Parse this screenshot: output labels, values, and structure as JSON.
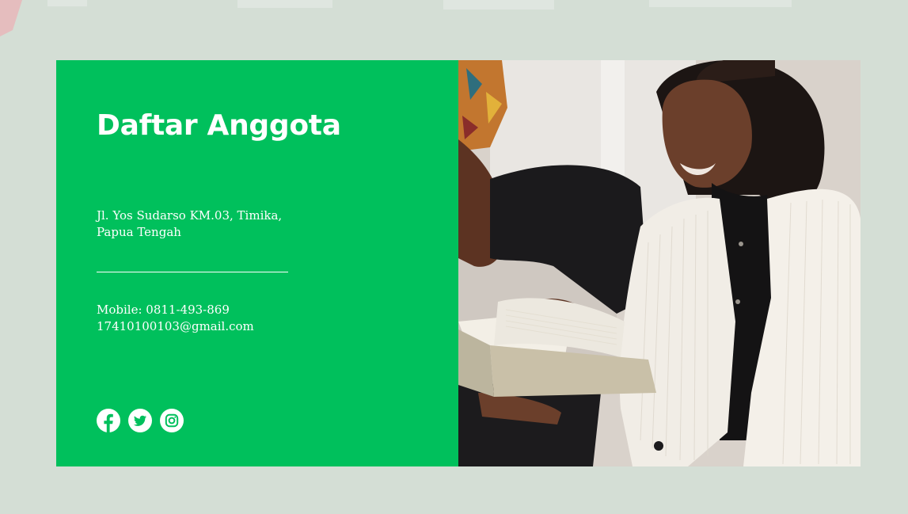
{
  "card": {
    "title": "Daftar Anggota",
    "address_line1": "Jl. Yos Sudarso KM.03, Timika,",
    "address_line2": "Papua Tengah",
    "mobile": "Mobile: 0811-493-869",
    "email": "17410100103@gmail.com"
  },
  "socials": [
    {
      "icon": "facebook-icon"
    },
    {
      "icon": "twitter-icon"
    },
    {
      "icon": "instagram-icon"
    }
  ],
  "colors": {
    "page_background": "#d4ded5",
    "panel_green": "#00c05c",
    "text": "#ffffff",
    "watermark": "#e8aeb3"
  },
  "photo": {
    "subject": "woman-reading-book-photo"
  }
}
